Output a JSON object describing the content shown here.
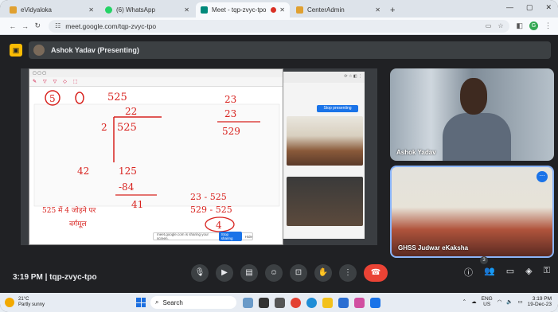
{
  "browser": {
    "tabs": [
      {
        "title": "eVidyaloka",
        "color": "#e0a030",
        "active": false
      },
      {
        "title": "(6) WhatsApp",
        "color": "#25d366",
        "active": false
      },
      {
        "title": "Meet - tqp-zvyc-tpo",
        "color": "#00897b",
        "active": true,
        "recording": true
      },
      {
        "title": "CenterAdmin",
        "color": "#e0a030",
        "active": false
      }
    ],
    "url": "meet.google.com/tqp-zvyc-tpo",
    "profile_initial": "G"
  },
  "meet": {
    "presenter_label": "Ashok Yadav (Presenting)",
    "meeting_time": "3:19 PM",
    "meeting_code": "tqp-zvyc-tpo",
    "participants_count": "3",
    "tiles": [
      {
        "name": "Ashok Yadav"
      },
      {
        "name": "GHSS Judwar eKaksha"
      }
    ],
    "shared_screen": {
      "stop_presenting": "Stop presenting",
      "banner_text": "meet.google.com is sharing your screen.",
      "banner_stop": "Stop sharing",
      "banner_hide": "Hide"
    }
  },
  "whiteboard": {
    "top_number": "525",
    "circled": "5",
    "quotient": "22",
    "divisor": "2",
    "dividend": "525",
    "steps": [
      "42",
      "125",
      "-84",
      "41"
    ],
    "check_lines": [
      "23",
      "23",
      "529"
    ],
    "result_lines": [
      "23 - 525",
      "529 - 525"
    ],
    "remainder": "4",
    "note_line1": "525 में 4 जोड़ने पर",
    "note_line2": "वर्गमूल"
  },
  "windows": {
    "weather_temp": "21°C",
    "weather_desc": "Partly sunny",
    "search_placeholder": "Search",
    "lang_top": "ENG",
    "lang_bottom": "US",
    "time": "3:19 PM",
    "date": "19-Dec-23"
  }
}
